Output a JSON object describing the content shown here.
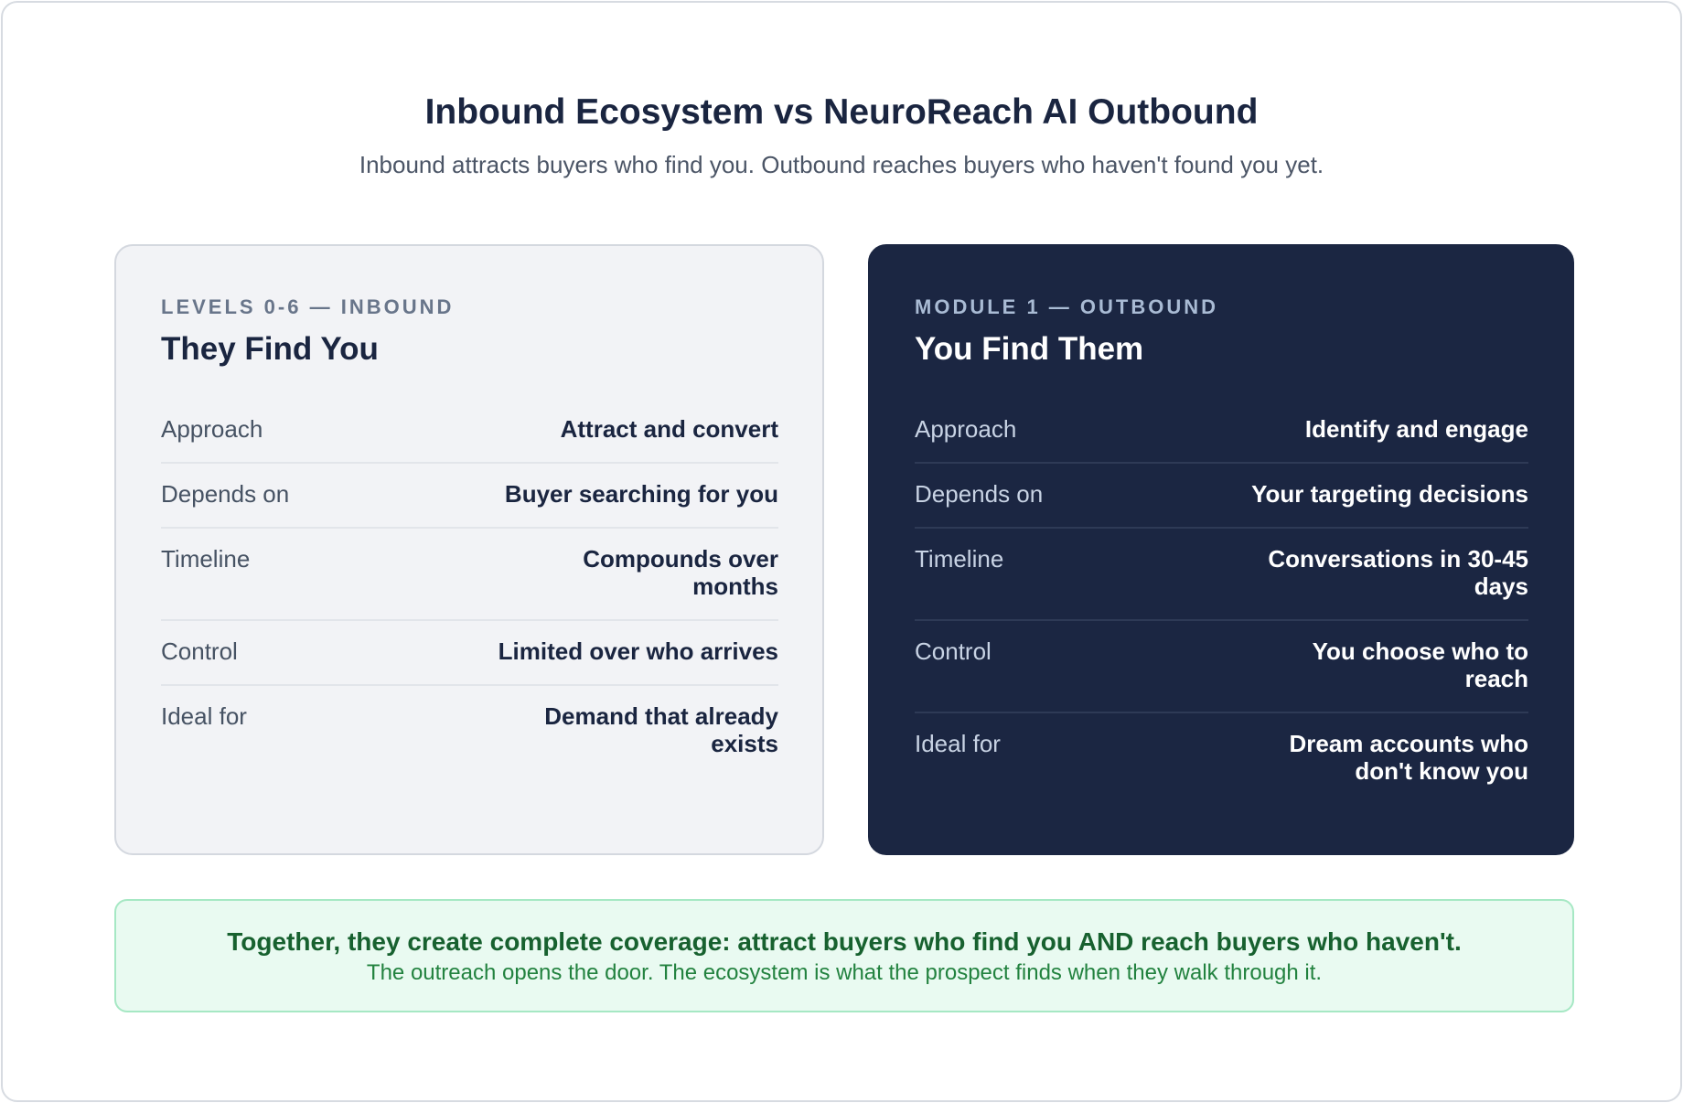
{
  "header": {
    "title": "Inbound Ecosystem vs NeuroReach AI Outbound",
    "subtitle": "Inbound attracts buyers who find you. Outbound reaches buyers who haven't found you yet."
  },
  "inbound": {
    "eyebrow": "LEVELS 0-6 — INBOUND",
    "title": "They Find You",
    "rows": [
      {
        "label": "Approach",
        "value": "Attract and convert"
      },
      {
        "label": "Depends on",
        "value": "Buyer searching for you"
      },
      {
        "label": "Timeline",
        "value": "Compounds over months"
      },
      {
        "label": "Control",
        "value": "Limited over who arrives"
      },
      {
        "label": "Ideal for",
        "value": "Demand that already exists"
      }
    ]
  },
  "outbound": {
    "eyebrow": "MODULE 1 — OUTBOUND",
    "title": "You Find Them",
    "rows": [
      {
        "label": "Approach",
        "value": "Identify and engage"
      },
      {
        "label": "Depends on",
        "value": "Your targeting decisions"
      },
      {
        "label": "Timeline",
        "value": "Conversations in 30-45 days"
      },
      {
        "label": "Control",
        "value": "You choose who to reach"
      },
      {
        "label": "Ideal for",
        "value": "Dream accounts who don't know you"
      }
    ]
  },
  "banner": {
    "headline": "Together, they create complete coverage: attract buyers who find you AND reach buyers who haven't.",
    "subtext": "The outreach opens the door. The ecosystem is what the prospect finds when they walk through it."
  },
  "colors": {
    "navy": "#1b2642",
    "light_card": "#f2f3f6",
    "banner_bg": "#e9faf1",
    "banner_text": "#17612f"
  }
}
